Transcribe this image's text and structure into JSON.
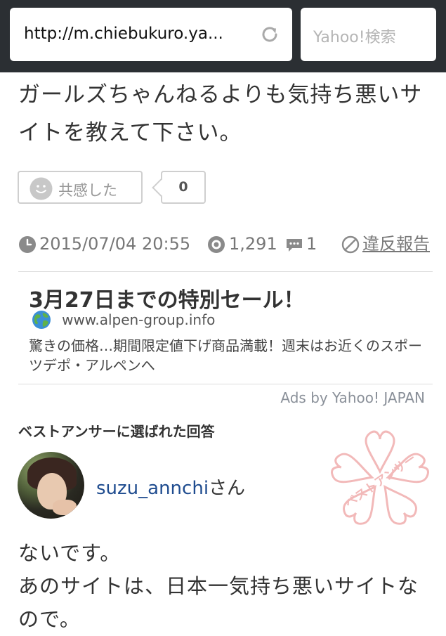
{
  "browser": {
    "url": "http://m.chiebukuro.ya...",
    "search_placeholder": "Yahoo!検索"
  },
  "question": {
    "text": "ガールズちゃんねるよりも気持ち悪いサイトを教えて下さい。",
    "empathy_label": "共感した",
    "empathy_count": "0"
  },
  "meta": {
    "datetime": "2015/07/04 20:55",
    "views": "1,291",
    "answers": "1",
    "report_label": "違反報告"
  },
  "ad": {
    "title": "3月27日までの特別セール！",
    "url": "www.alpen-group.info",
    "description": "驚きの価格…期間限定値下げ商品満載！週末はお近くのスポーツデポ・アルペンへ",
    "ads_by": "Ads by Yahoo! JAPAN"
  },
  "best_answer": {
    "heading": "ベストアンサーに選ばれた回答",
    "stamp_text": "ベストアンサー",
    "username": "suzu_annchi",
    "honorific": "さん",
    "answer_line1": "ないです。",
    "answer_line2": "あのサイトは、日本一気持ち悪いサイトなので。"
  },
  "colors": {
    "topbar": "#2b2f33",
    "link": "#1f4c8f",
    "stamp": "#f2b9b9"
  }
}
